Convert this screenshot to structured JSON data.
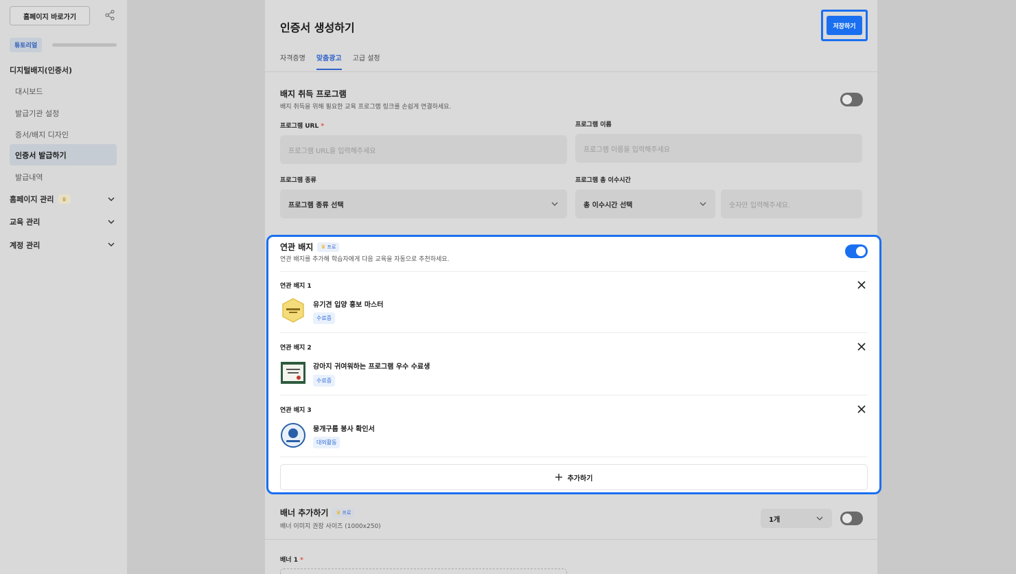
{
  "sidebar": {
    "home_button": "홈페이지 바로가기",
    "tutorial_badge": "튜토리얼",
    "sections": {
      "digital_badge": "디지털배지(인증서)",
      "homepage": "홈페이지 관리",
      "education": "교육 관리",
      "account": "계정 관리"
    },
    "items": [
      {
        "label": "대시보드"
      },
      {
        "label": "발급기관 설정"
      },
      {
        "label": "증서/배지 디자인"
      },
      {
        "label": "인증서 발급하기"
      },
      {
        "label": "발급내역"
      }
    ]
  },
  "header": {
    "title": "인증서 생성하기",
    "save_label": "저장하기",
    "tabs": [
      {
        "label": "자격증명"
      },
      {
        "label": "맞춤광고"
      },
      {
        "label": "고급 설정"
      }
    ]
  },
  "program": {
    "title": "배지 취득 프로그램",
    "description": "배지 취득을 위해 필요한 교육 프로그램 링크를 손쉽게 연결하세요.",
    "url_label": "프로그램 URL",
    "url_required": "*",
    "url_placeholder": "프로그램 URL을 입력해주세요",
    "name_label": "프로그램 이름",
    "name_placeholder": "프로그램 이름을 입력해주세요",
    "type_label": "프로그램 종류",
    "type_value": "프로그램 종류 선택",
    "hours_label": "프로그램 총 이수시간",
    "hours_value": "총 이수시간 선택",
    "hours_placeholder": "숫자만 입력해주세요."
  },
  "related": {
    "title": "연관 배지",
    "pro_label": "프로",
    "description": "연관 배지를 추가해 학습자에게 다음 교육을 자동으로 추천하세요.",
    "badges": [
      {
        "label": "연관 배지 1",
        "name": "유기견 입양 홍보 마스터",
        "tag": "수료증"
      },
      {
        "label": "연관 배지 2",
        "name": "강아지 귀여워하는 프로그램 우수 수료생",
        "tag": "수료증"
      },
      {
        "label": "연관 배지 3",
        "name": "뭉개구름 봉사 확인서",
        "tag": "대외활동"
      }
    ],
    "add_label": "추가하기"
  },
  "banner": {
    "title": "배너 추가하기",
    "pro_label": "프로",
    "description": "배너 이미지 권장 사이즈 (1000x250)",
    "count_value": "1개",
    "item_label": "배너 1",
    "item_required": "*"
  },
  "colors": {
    "accent": "#1a6ff0"
  }
}
